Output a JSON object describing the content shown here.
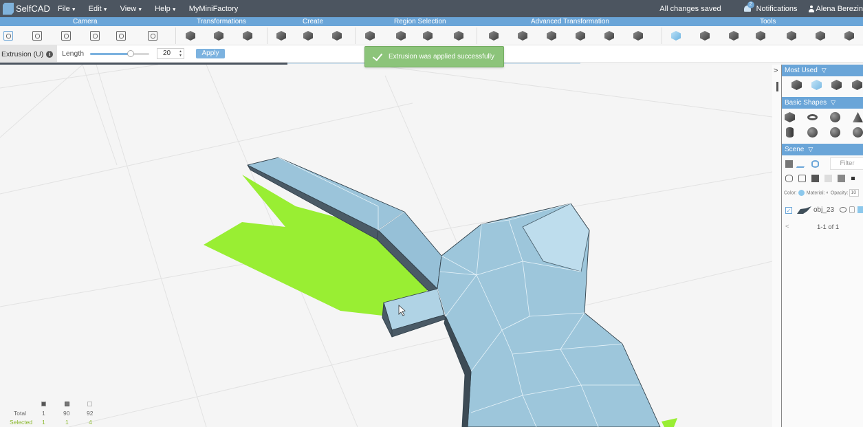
{
  "app": {
    "name": "SelfCAD"
  },
  "menu": {
    "items": [
      {
        "label": "File",
        "has_caret": true
      },
      {
        "label": "Edit",
        "has_caret": true
      },
      {
        "label": "View",
        "has_caret": true
      },
      {
        "label": "Help",
        "has_caret": true
      },
      {
        "label": "MyMiniFactory",
        "has_caret": false
      }
    ],
    "status": "All changes saved",
    "notifications_label": "Notifications",
    "notifications_count": "2",
    "user": "Alena Berezin"
  },
  "sections": [
    "Camera",
    "Transformations",
    "Create",
    "Region Selection",
    "Advanced Transformation",
    "Tools"
  ],
  "option_bar": {
    "tool_name": "Extrusion (U)",
    "info_icon": "info-icon",
    "length_label": "Length",
    "slider_fraction": 0.69,
    "length_value": "20",
    "apply_label": "Apply"
  },
  "toast": {
    "message": "Extrusion was applied successfully",
    "icon": "check-icon"
  },
  "stats": {
    "total_label": "Total",
    "selected_label": "Selected",
    "total": [
      "1",
      "90",
      "92"
    ],
    "selected": [
      "1",
      "1",
      "4"
    ]
  },
  "panel": {
    "most_used": "Most Used",
    "basic_shapes": "Basic Shapes",
    "scene": "Scene",
    "filter_placeholder": "Filter",
    "color_label": "Color:",
    "material_label": "Material:",
    "opacity_label": "Opacity:",
    "opacity_value": "10",
    "object_name": "obj_23",
    "pager": "1-1 of 1"
  },
  "colors": {
    "menubar": "#4c5560",
    "section_bar": "#6aa5d8",
    "model_fill": "#9ac3d9",
    "selection_green": "#99ee33",
    "toast": "#8cc47a"
  }
}
